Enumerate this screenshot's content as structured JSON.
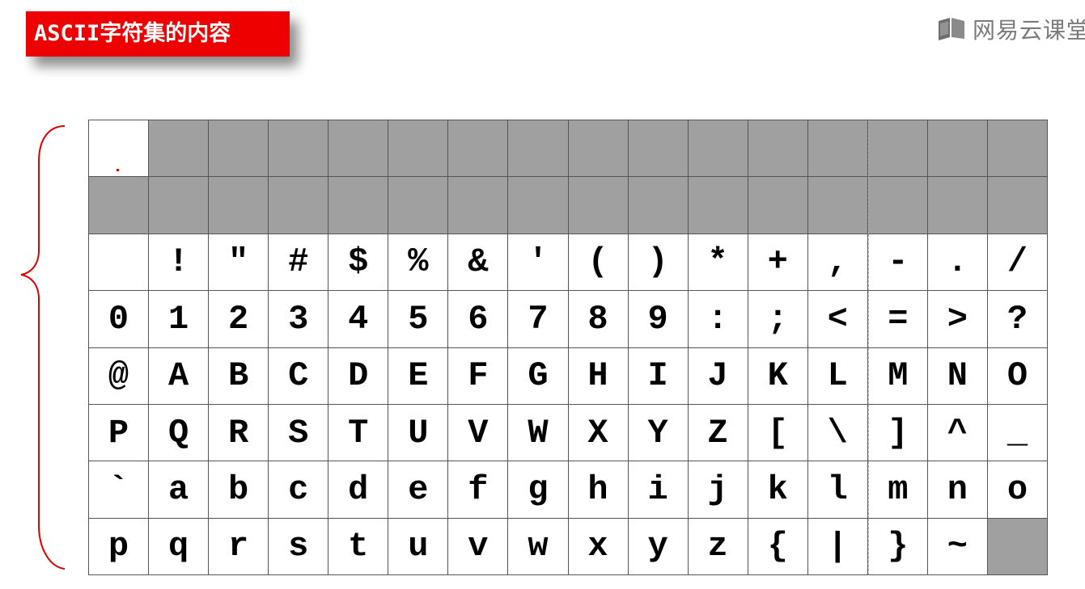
{
  "header": {
    "title": "ASCII字符集的内容"
  },
  "watermark": {
    "text": "网易云课堂",
    "icon": "book-screen-icon"
  },
  "annotation": {
    "icon": "curly-brace-icon",
    "color": "#dd0000"
  },
  "colors": {
    "banner": "#ee0000",
    "control_cell": "#a0a0a0",
    "grid_line": "#555555"
  },
  "ascii_table": {
    "columns": 16,
    "rows": [
      [
        "",
        "",
        "",
        "",
        "",
        "",
        "",
        "",
        "",
        "",
        "",
        "",
        "",
        "",
        "",
        ""
      ],
      [
        "",
        "",
        "",
        "",
        "",
        "",
        "",
        "",
        "",
        "",
        "",
        "",
        "",
        "",
        "",
        ""
      ],
      [
        " ",
        "!",
        "\"",
        "#",
        "$",
        "%",
        "&",
        "'",
        "(",
        ")",
        "*",
        "+",
        ",",
        "-",
        ".",
        "/"
      ],
      [
        "0",
        "1",
        "2",
        "3",
        "4",
        "5",
        "6",
        "7",
        "8",
        "9",
        ":",
        ";",
        "<",
        "=",
        ">",
        "?"
      ],
      [
        "@",
        "A",
        "B",
        "C",
        "D",
        "E",
        "F",
        "G",
        "H",
        "I",
        "J",
        "K",
        "L",
        "M",
        "N",
        "O"
      ],
      [
        "P",
        "Q",
        "R",
        "S",
        "T",
        "U",
        "V",
        "W",
        "X",
        "Y",
        "Z",
        "[",
        "\\",
        "]",
        "^",
        "_"
      ],
      [
        "`",
        "a",
        "b",
        "c",
        "d",
        "e",
        "f",
        "g",
        "h",
        "i",
        "j",
        "k",
        "l",
        "m",
        "n",
        "o"
      ],
      [
        "p",
        "q",
        "r",
        "s",
        "t",
        "u",
        "v",
        "w",
        "x",
        "y",
        "z",
        "{",
        "|",
        "}",
        "~",
        ""
      ]
    ],
    "control_cells": [
      [
        0,
        1
      ],
      [
        0,
        2
      ],
      [
        0,
        3
      ],
      [
        0,
        4
      ],
      [
        0,
        5
      ],
      [
        0,
        6
      ],
      [
        0,
        7
      ],
      [
        0,
        8
      ],
      [
        0,
        9
      ],
      [
        0,
        10
      ],
      [
        0,
        11
      ],
      [
        0,
        12
      ],
      [
        0,
        13
      ],
      [
        0,
        14
      ],
      [
        0,
        15
      ],
      [
        1,
        0
      ],
      [
        1,
        1
      ],
      [
        1,
        2
      ],
      [
        1,
        3
      ],
      [
        1,
        4
      ],
      [
        1,
        5
      ],
      [
        1,
        6
      ],
      [
        1,
        7
      ],
      [
        1,
        8
      ],
      [
        1,
        9
      ],
      [
        1,
        10
      ],
      [
        1,
        11
      ],
      [
        1,
        12
      ],
      [
        1,
        13
      ],
      [
        1,
        14
      ],
      [
        1,
        15
      ],
      [
        7,
        15
      ]
    ],
    "selected_cell": [
      0,
      0
    ]
  }
}
